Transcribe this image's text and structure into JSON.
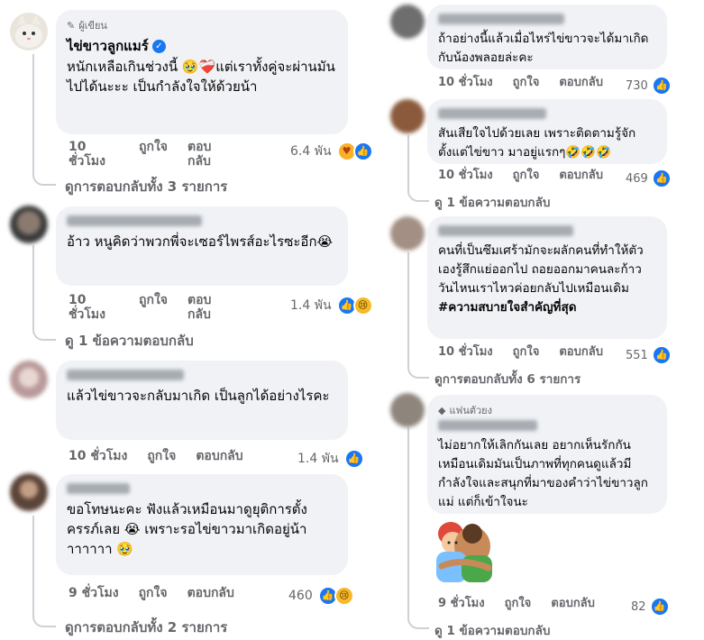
{
  "comments_left": [
    {
      "badge": "ผู้เขียน",
      "author": "ไข่ขาวลูกแมร์",
      "text": "หนักเหลือเกินช่วงนี้ 🥹❤️‍🩹แต่เราทั้งคู่จะผ่านมันไปได้นะะะ เป็นกำลังใจให้ด้วยน้า",
      "time": "10 ชั่วโมง",
      "like": "ถูกใจ",
      "reply": "ตอบกลับ",
      "reactions": "6.4 พัน",
      "view_replies": "ดูการตอบกลับทั้ง 3 รายการ"
    },
    {
      "text": "อ้าว หนูคิดว่าพวกพี่จะเซอร์ไพรส์อะไรซะอีก😭",
      "time": "10 ชั่วโมง",
      "like": "ถูกใจ",
      "reply": "ตอบกลับ",
      "reactions": "1.4 พัน",
      "view_replies": "ดู 1 ข้อความตอบกลับ"
    },
    {
      "text": "แล้วไข่ขาวจะกลับมาเกิด เป็นลูกได้อย่างไรคะ",
      "time": "10 ชั่วโมง",
      "like": "ถูกใจ",
      "reply": "ตอบกลับ",
      "reactions": "1.4 พัน"
    },
    {
      "text": "ขอโทษนะคะ ฟังแล้วเหมือนมาดูยุติการตั้งครรภ์เลย 😭 เพราะรอไข่ขาวมาเกิดอยู่น้าาาาาาา 🥹",
      "time": "9 ชั่วโมง",
      "like": "ถูกใจ",
      "reply": "ตอบกลับ",
      "reactions": "460",
      "view_replies": "ดูการตอบกลับทั้ง 2 รายการ"
    }
  ],
  "comments_right": [
    {
      "text": "ถ้าอย่างนี้แล้วเมื่อไหร่ไข่ขาวจะได้มาเกิดกับน้องพลอยล่ะคะ",
      "time": "10 ชั่วโมง",
      "like": "ถูกใจ",
      "reply": "ตอบกลับ",
      "reactions": "730"
    },
    {
      "text": "สันเสียใจไปด้วยเลย เพราะติดตามรู้จักตั้งแต่ไข่ขาว มาอยู่แรกๆ🤣🤣🤣",
      "time": "10 ชั่วโมง",
      "like": "ถูกใจ",
      "reply": "ตอบกลับ",
      "reactions": "469",
      "view_replies": "ดู 1 ข้อความตอบกลับ"
    },
    {
      "text": "คนที่เป็นซึมเศร้ามักจะผลักคนที่ทำให้ตัวเองรู้สึกแย่ออกไป ถอยออกมาคนละก้าว วันไหนเราไหวค่อยกลับไปเหมือนเดิม",
      "hashtag": "#ความสบายใจสำคัญที่สุด",
      "time": "10 ชั่วโมง",
      "like": "ถูกใจ",
      "reply": "ตอบกลับ",
      "reactions": "551",
      "view_replies": "ดูการตอบกลับทั้ง 6 รายการ"
    },
    {
      "badge": "แฟนตัวยง",
      "text": "ไม่อยากให้เลิกกันเลย อยากเห็นรักกันเหมือนเดิมมันเป็นภาพที่ทุกคนดูแล้วมีกำลังใจและสนุกที่มาของคำว่าไข่ขาวลูกแม่ แต่ก็เข้าใจนะ",
      "time": "9 ชั่วโมง",
      "like": "ถูกใจ",
      "reply": "ตอบกลับ",
      "reactions": "82",
      "view_replies": "ดู 1 ข้อความตอบกลับ"
    }
  ],
  "colors": {
    "accent": "#1877f2",
    "bubble": "#f0f2f5",
    "meta": "#65676b"
  },
  "icons": [
    "verified-icon",
    "like-reaction-icon",
    "care-reaction-icon",
    "sad-reaction-icon",
    "hug-sticker",
    "diamond-icon",
    "pen-icon"
  ]
}
